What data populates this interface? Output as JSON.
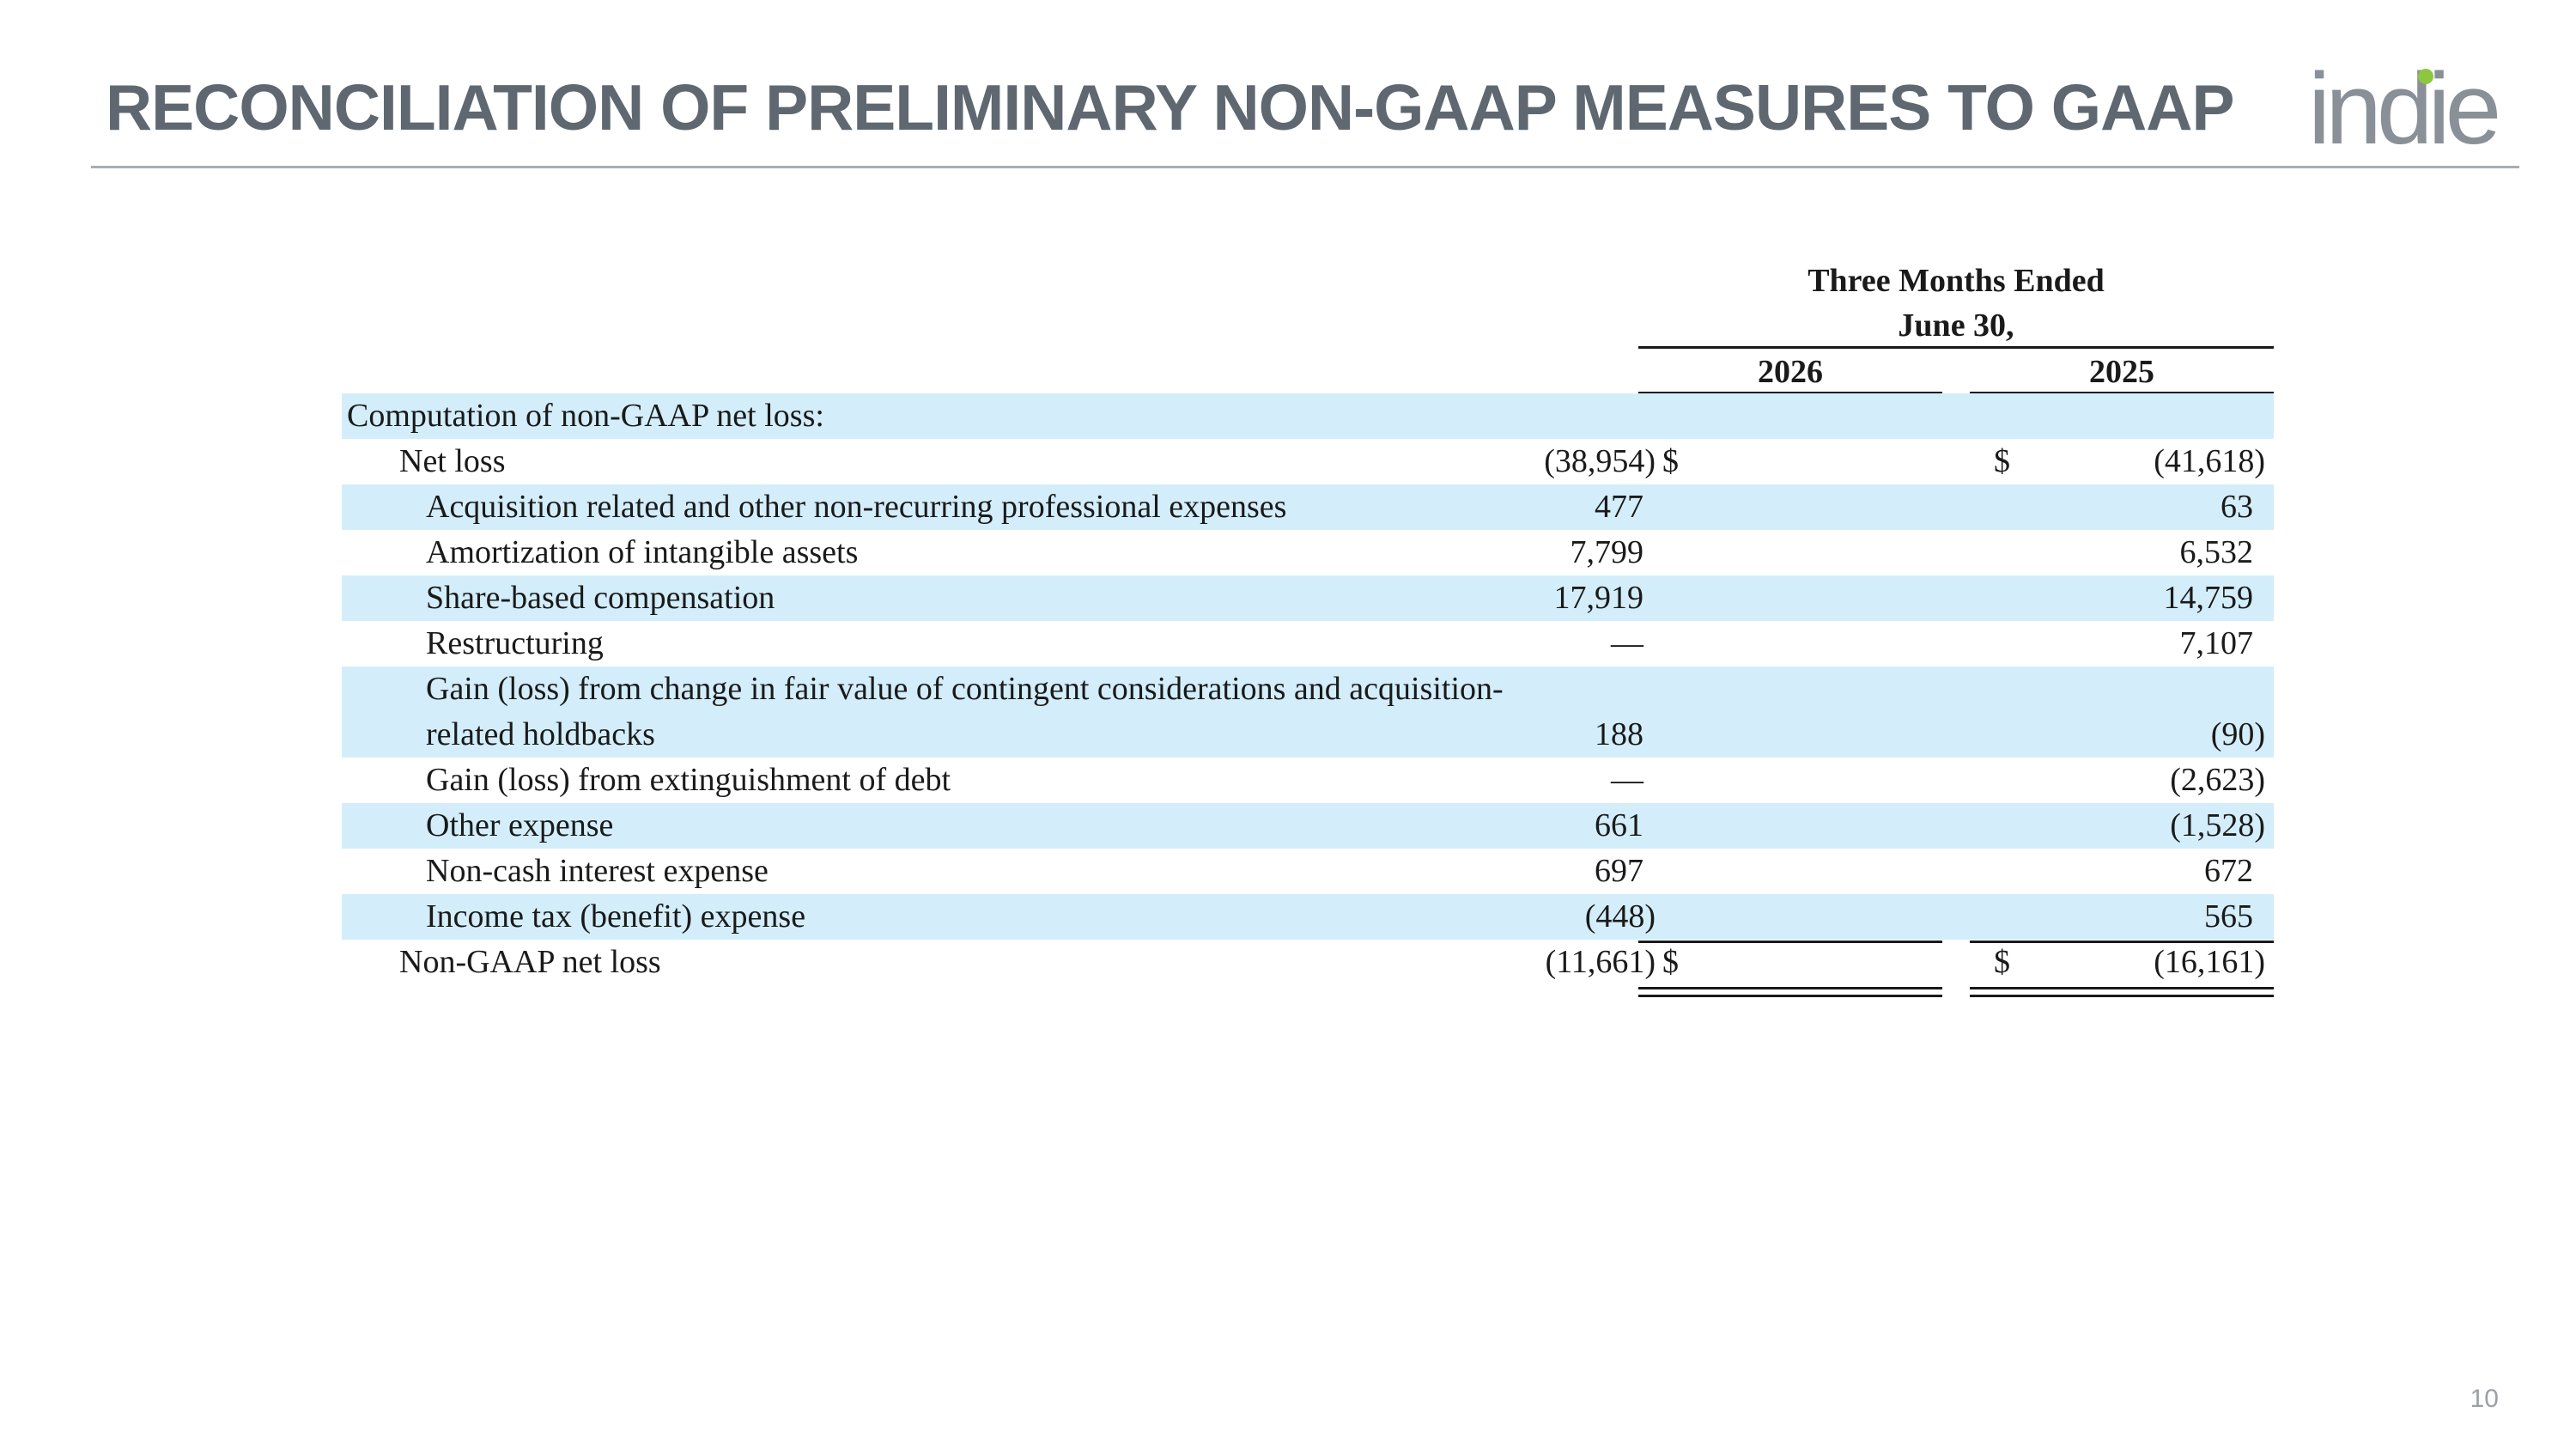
{
  "title": "RECONCILIATION OF PRELIMINARY NON-GAAP MEASURES TO GAAP",
  "logo_text": "indie",
  "brand_colors": {
    "title": "#5f6870",
    "logo": "#8a9097",
    "logo_accent": "#8dc63f",
    "row_shade": "#d3eefa"
  },
  "table": {
    "period_header": [
      "Three Months Ended",
      "June 30,"
    ],
    "columns": [
      "2026",
      "2025"
    ],
    "rows": [
      {
        "label": "Computation of non-GAAP net loss:",
        "indent": 0,
        "shaded": true,
        "cur_a": "",
        "val_a": "",
        "cur_b": "",
        "val_b": ""
      },
      {
        "label": "Net loss",
        "indent": 1,
        "shaded": false,
        "cur_a": "$",
        "val_a": "(38,954)",
        "cur_b": "$",
        "val_b": "(41,618)"
      },
      {
        "label": "Acquisition related and other non-recurring professional expenses",
        "indent": 2,
        "shaded": true,
        "cur_a": "",
        "val_a": "477",
        "cur_b": "",
        "val_b": "63"
      },
      {
        "label": "Amortization of intangible assets",
        "indent": 2,
        "shaded": false,
        "cur_a": "",
        "val_a": "7,799",
        "cur_b": "",
        "val_b": "6,532"
      },
      {
        "label": "Share-based compensation",
        "indent": 2,
        "shaded": true,
        "cur_a": "",
        "val_a": "17,919",
        "cur_b": "",
        "val_b": "14,759"
      },
      {
        "label": "Restructuring",
        "indent": 2,
        "shaded": false,
        "cur_a": "",
        "val_a": "—",
        "cur_b": "",
        "val_b": "7,107"
      },
      {
        "label": "Gain (loss) from change in fair value of contingent considerations and acquisition-",
        "label2": "related holdbacks",
        "indent": 2,
        "shaded": true,
        "tall": true,
        "cur_a": "",
        "val_a": "188",
        "cur_b": "",
        "val_b": "(90)"
      },
      {
        "label": "Gain (loss) from extinguishment of debt",
        "indent": 2,
        "shaded": false,
        "cur_a": "",
        "val_a": "—",
        "cur_b": "",
        "val_b": "(2,623)"
      },
      {
        "label": "Other expense",
        "indent": 2,
        "shaded": true,
        "cur_a": "",
        "val_a": "661",
        "cur_b": "",
        "val_b": "(1,528)"
      },
      {
        "label": "Non-cash interest expense",
        "indent": 2,
        "shaded": false,
        "cur_a": "",
        "val_a": "697",
        "cur_b": "",
        "val_b": "672"
      },
      {
        "label": "Income tax (benefit) expense",
        "indent": 2,
        "shaded": true,
        "cur_a": "",
        "val_a": "(448)",
        "cur_b": "",
        "val_b": "565"
      },
      {
        "label": "Non-GAAP net loss",
        "indent": 1,
        "shaded": false,
        "cur_a": "$",
        "val_a": "(11,661)",
        "cur_b": "$",
        "val_b": "(16,161)"
      }
    ]
  },
  "page_number": "10"
}
